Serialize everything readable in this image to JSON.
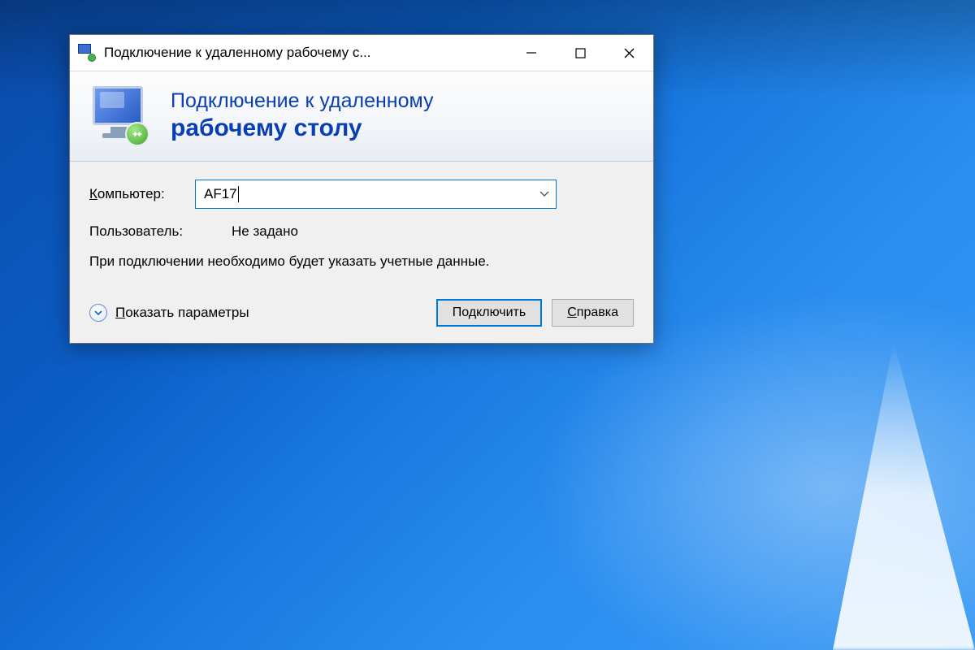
{
  "window": {
    "title": "Подключение к удаленному рабочему с..."
  },
  "header": {
    "line1": "Подключение к удаленному",
    "line2": "рабочему столу"
  },
  "form": {
    "computer_label_ul": "К",
    "computer_label_rest": "омпьютер:",
    "computer_value": "AF17",
    "user_label": "Пользователь:",
    "user_value": "Не задано",
    "hint": "При подключении необходимо будет указать учетные данные."
  },
  "footer": {
    "show_options_ul": "П",
    "show_options_rest": "оказать параметры",
    "connect_label": "Подключить",
    "help_ul": "С",
    "help_rest": "правка"
  }
}
